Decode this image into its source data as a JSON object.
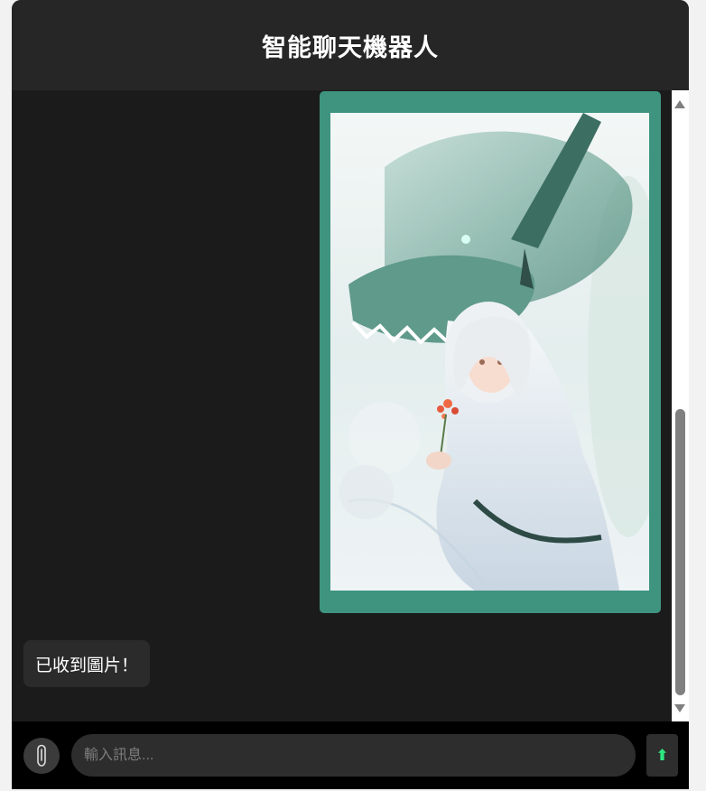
{
  "header": {
    "title": "智能聊天機器人"
  },
  "messages": [
    {
      "role": "user",
      "type": "image",
      "image_subject": "anime girl with white hair holding a red flower in front of a green dragon"
    },
    {
      "role": "bot",
      "type": "text",
      "text": "已收到圖片！"
    }
  ],
  "input": {
    "placeholder": "輸入訊息...",
    "value": ""
  },
  "icons": {
    "attach": "paperclip-icon",
    "send": "arrow-up-icon"
  },
  "colors": {
    "header_bg": "#262626",
    "chat_bg": "#1b1b1b",
    "user_bubble": "#3f9480",
    "bot_bubble": "#2b2b2b",
    "send_arrow": "#2ee87f"
  }
}
